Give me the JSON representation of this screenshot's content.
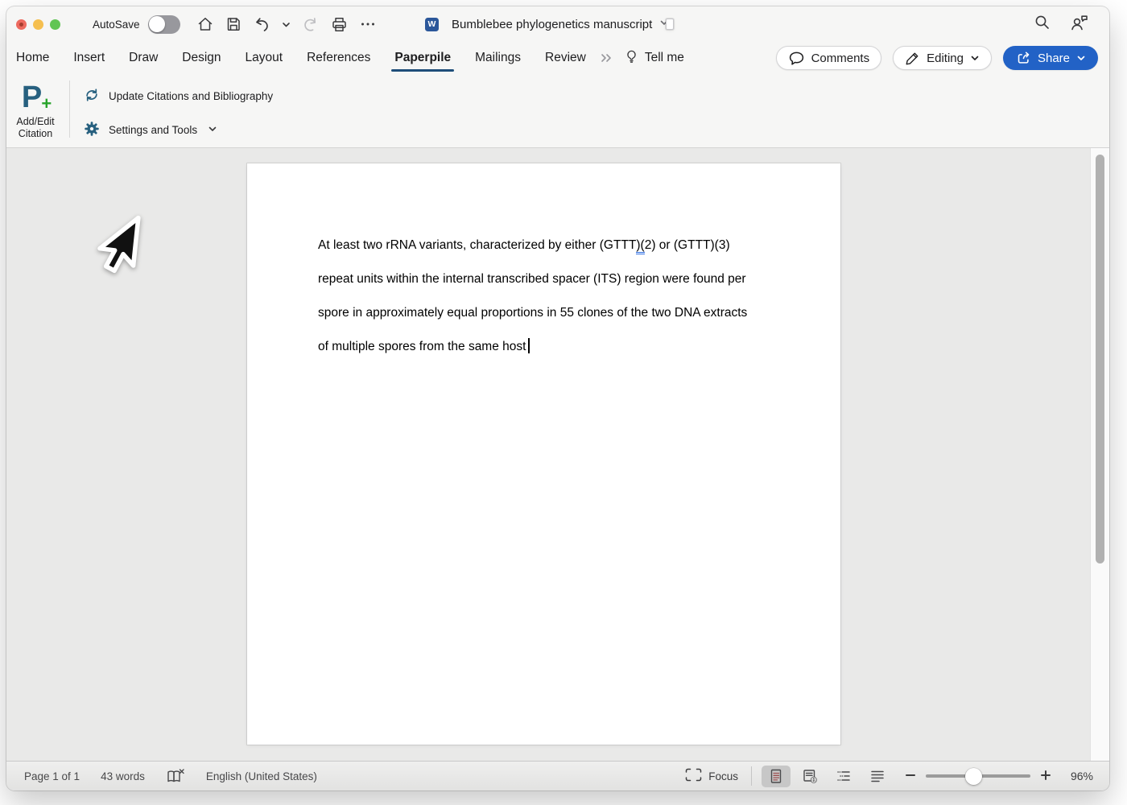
{
  "titlebar": {
    "autosave_label": "AutoSave",
    "document_title": "Bumblebee phylogenetics manuscript"
  },
  "tabs": {
    "items": [
      {
        "label": "Home"
      },
      {
        "label": "Insert"
      },
      {
        "label": "Draw"
      },
      {
        "label": "Design"
      },
      {
        "label": "Layout"
      },
      {
        "label": "References"
      },
      {
        "label": "Paperpile"
      },
      {
        "label": "Mailings"
      },
      {
        "label": "Review"
      }
    ],
    "active_tab": "Paperpile",
    "tell_me_label": "Tell me"
  },
  "actions": {
    "comments_label": "Comments",
    "editing_label": "Editing",
    "share_label": "Share"
  },
  "ribbon": {
    "add_edit_citation_label_line1": "Add/Edit",
    "add_edit_citation_label_line2": "Citation",
    "update_citations_label": "Update Citations and Bibliography",
    "settings_and_tools_label": "Settings and Tools"
  },
  "document": {
    "line1_pre": "At least two rRNA variants, characterized by either (GTTT",
    "line1_grammar_marked": ")(",
    "line1_post": "2) or (GTTT)(3)",
    "line2": "repeat units within the internal transcribed spacer (ITS) region were found per",
    "line3": "spore in approximately equal proportions in 55 clones of the two DNA extracts",
    "line4": "of multiple spores from the same host"
  },
  "statusbar": {
    "page_indicator": "Page 1 of 1",
    "word_count": "43 words",
    "language": "English (United States)",
    "focus_label": "Focus",
    "zoom_level": "96%"
  },
  "colors": {
    "share_button_bg": "#2262c6",
    "active_tab_underline": "#1e4e79",
    "paperpile_blue": "#27607f",
    "paperpile_green": "#27a32a",
    "grammar_mark_blue": "#2f6fe4",
    "word_icon_blue": "#2b579a"
  }
}
